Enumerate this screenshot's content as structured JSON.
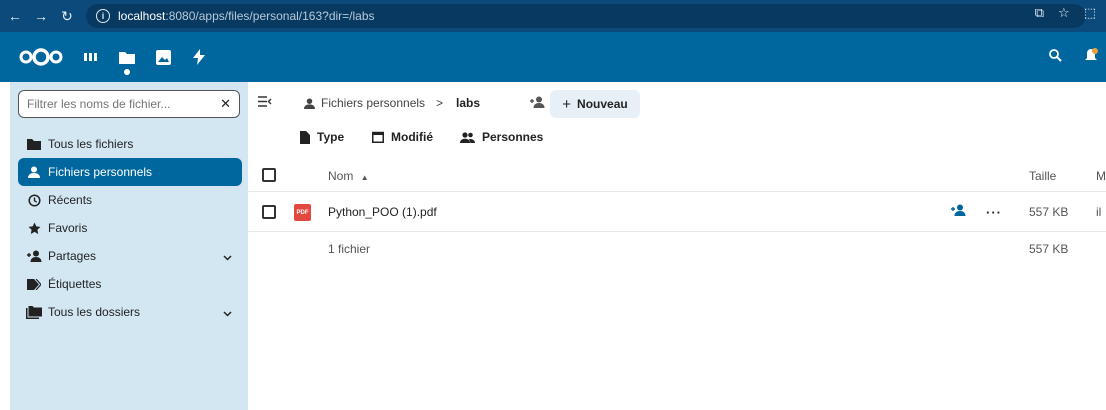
{
  "browser": {
    "url_host": "localhost",
    "url_path": ":8080/apps/files/personal/163?dir=/labs"
  },
  "sidebar": {
    "filter_placeholder": "Filtrer les noms de fichier...",
    "items": [
      {
        "label": "Tous les fichiers"
      },
      {
        "label": "Fichiers personnels"
      },
      {
        "label": "Récents"
      },
      {
        "label": "Favoris"
      },
      {
        "label": "Partages"
      },
      {
        "label": "Étiquettes"
      },
      {
        "label": "Tous les dossiers"
      }
    ]
  },
  "breadcrumb": {
    "home": "Fichiers personnels",
    "separator": ">",
    "current": "labs"
  },
  "toolbar": {
    "new_label": "Nouveau"
  },
  "filters": {
    "type": "Type",
    "modified": "Modifié",
    "people": "Personnes"
  },
  "table": {
    "col_name": "Nom",
    "col_size": "Taille",
    "col_modified": "M",
    "rows": [
      {
        "name": "Python_POO (1).pdf",
        "size": "557 KB",
        "modified": "il",
        "icon": "PDF"
      }
    ],
    "footer_count": "1 fichier",
    "footer_size": "557 KB"
  },
  "colors": {
    "header": "#00679e",
    "browser": "#0b4a7a",
    "sidebar": "#d3e7f3"
  }
}
